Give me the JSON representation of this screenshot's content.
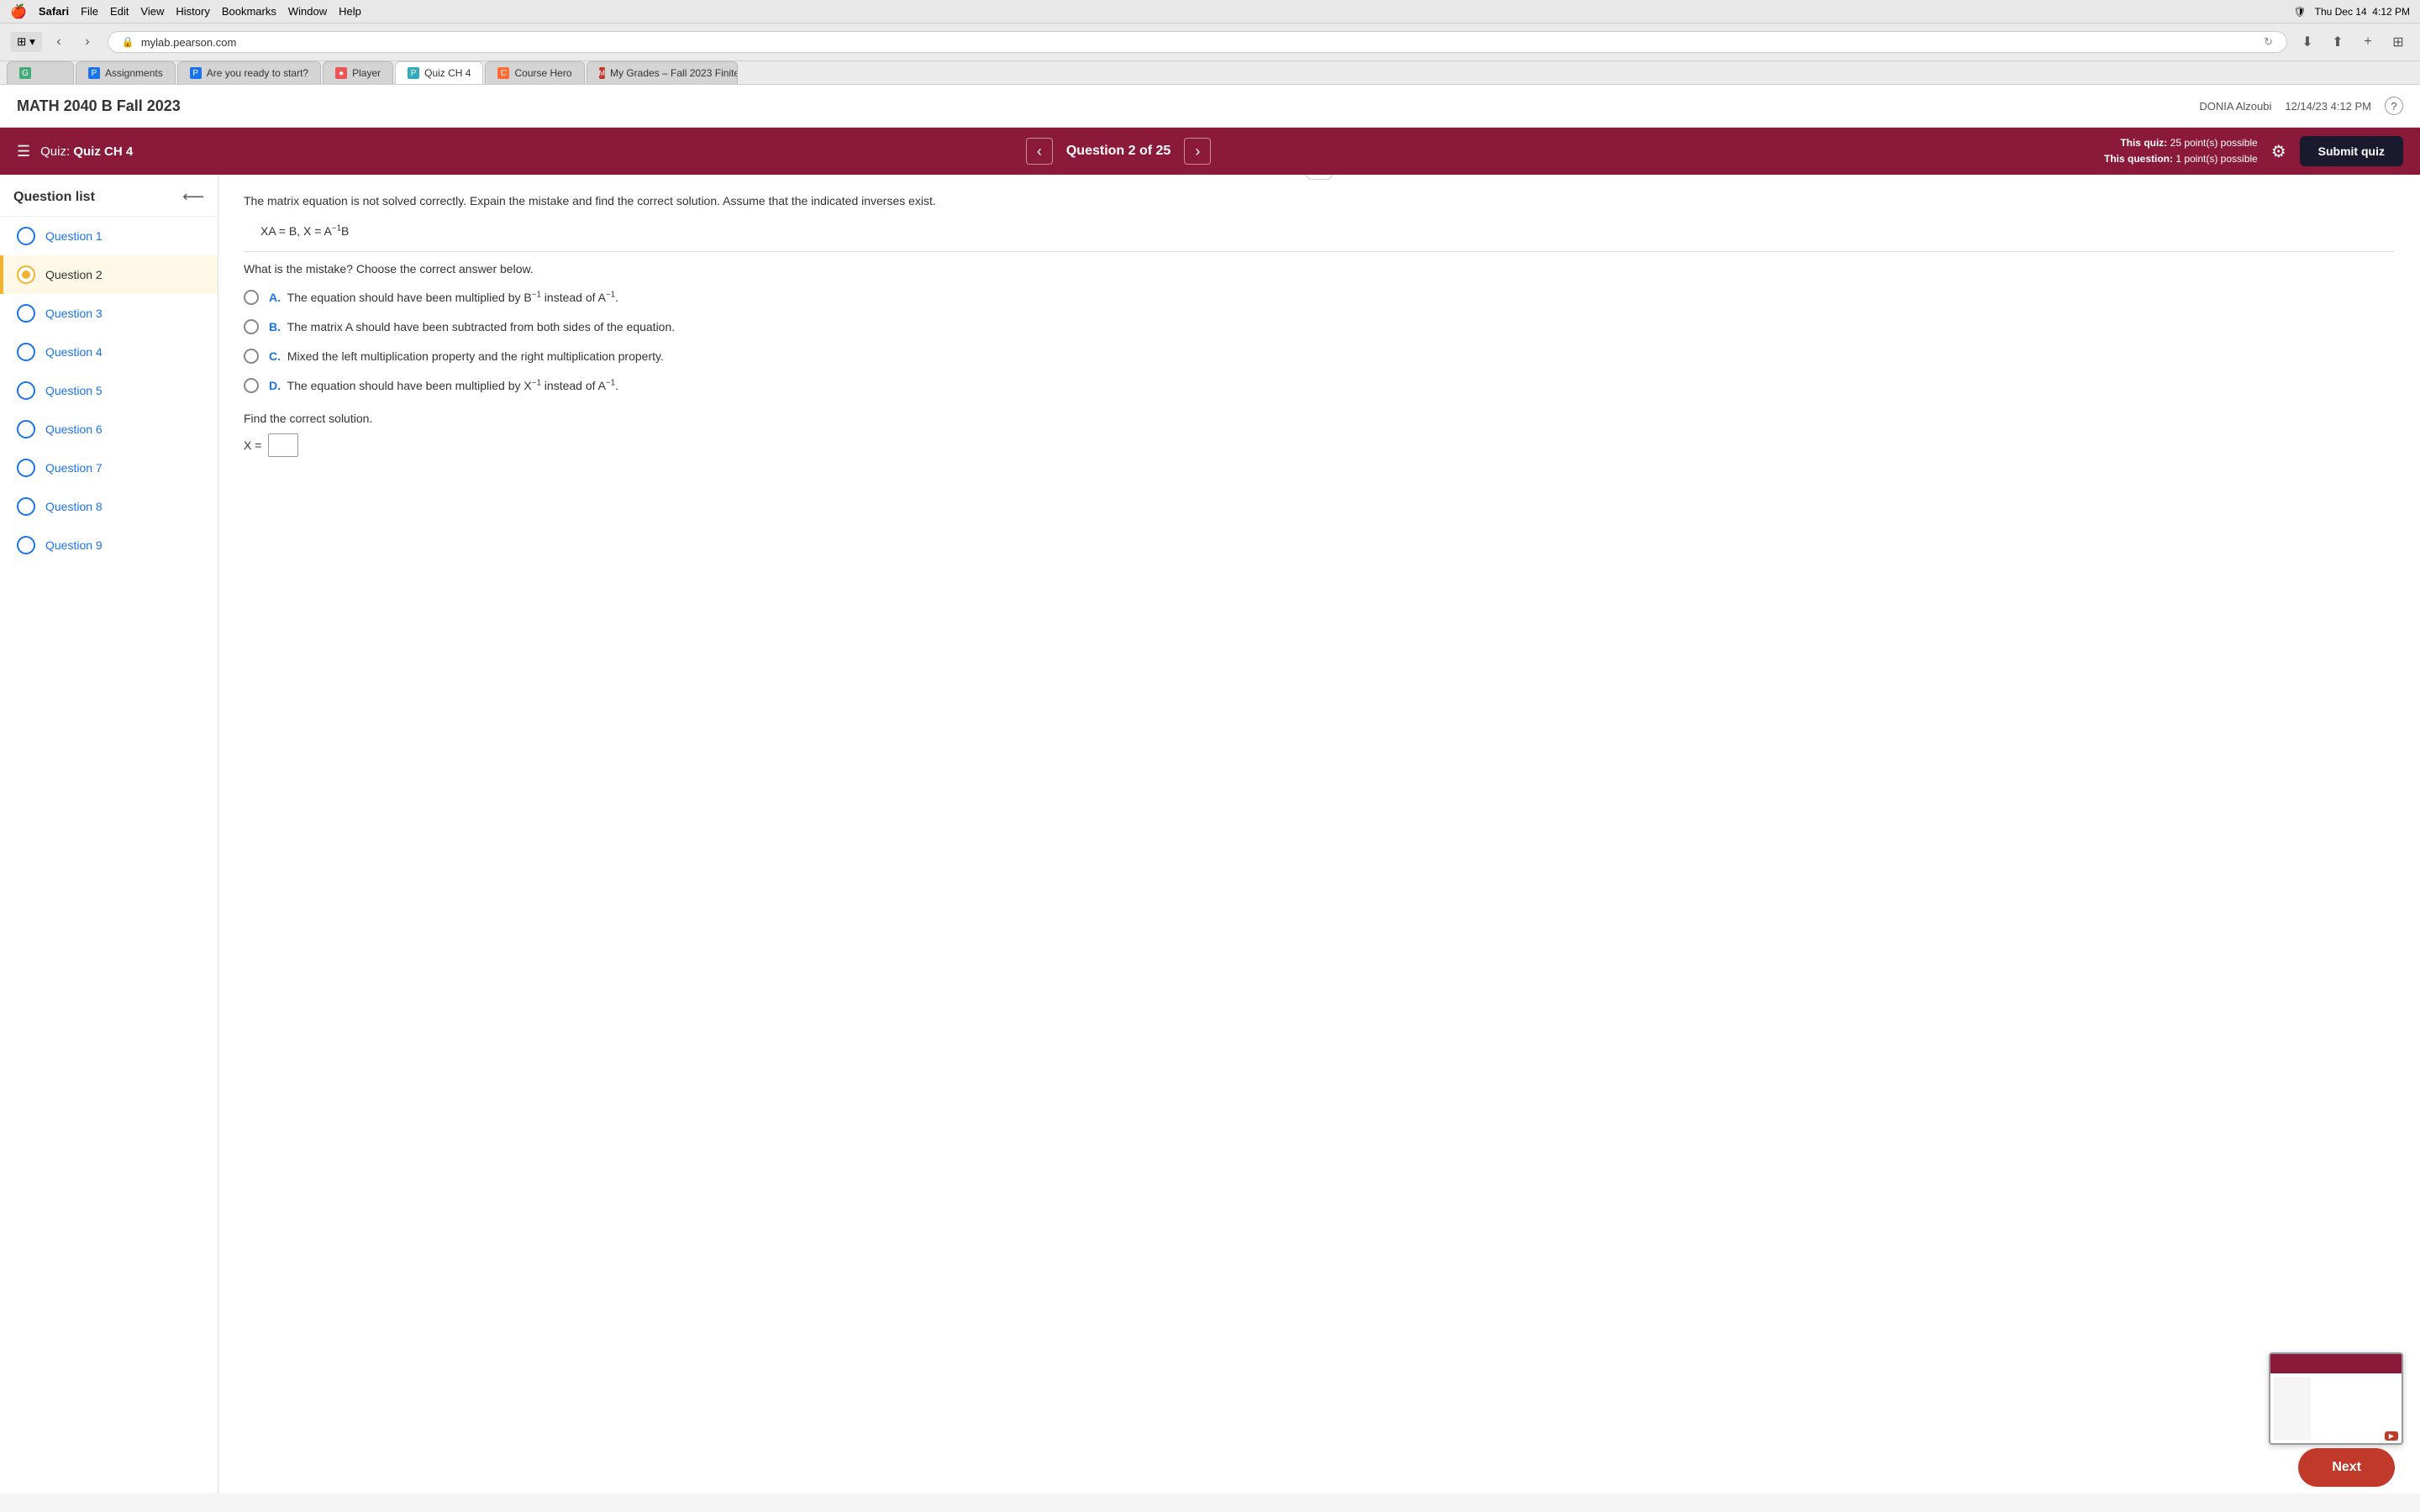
{
  "menubar": {
    "apple": "🍎",
    "items": [
      "Safari",
      "File",
      "Edit",
      "View",
      "History",
      "Bookmarks",
      "Window",
      "Help"
    ],
    "right_items": [
      "🛡",
      "Thu Dec 14",
      "4:12 PM"
    ]
  },
  "browser": {
    "address": "mylab.pearson.com",
    "lock_icon": "🔒"
  },
  "tabs": [
    {
      "id": "g-tab",
      "favicon_type": "green",
      "favicon_text": "G",
      "label": "",
      "active": false
    },
    {
      "id": "assignments-tab",
      "favicon_type": "blue",
      "favicon_text": "P",
      "label": "Assignments",
      "active": false
    },
    {
      "id": "start-tab",
      "favicon_type": "blue",
      "favicon_text": "P",
      "label": "Are you ready to start?",
      "active": false
    },
    {
      "id": "player-tab",
      "favicon_type": "red",
      "favicon_text": "●",
      "label": "Player",
      "active": false
    },
    {
      "id": "quiz-tab",
      "favicon_type": "lightblue",
      "favicon_text": "P",
      "label": "Quiz CH 4",
      "active": true
    },
    {
      "id": "coursehero-tab",
      "favicon_type": "coursehero",
      "favicon_text": "C",
      "label": "Course Hero",
      "active": false
    },
    {
      "id": "grades-tab",
      "favicon_type": "grades",
      "favicon_text": "M",
      "label": "My Grades – Fall 2023 Finite...",
      "active": false
    }
  ],
  "site_header": {
    "title": "MATH 2040 B Fall 2023",
    "user": "DONIA Alzoubi",
    "datetime": "12/14/23 4:12 PM",
    "help_icon": "?"
  },
  "quiz_header": {
    "menu_icon": "☰",
    "quiz_label": "Quiz:",
    "quiz_name": "Quiz CH 4",
    "prev_icon": "‹",
    "next_icon": "›",
    "question_indicator": "Question 2 of 25",
    "this_quiz_label": "This quiz:",
    "this_quiz_value": "25 point(s) possible",
    "this_question_label": "This question:",
    "this_question_value": "1 point(s) possible",
    "settings_icon": "⚙",
    "submit_btn": "Submit quiz"
  },
  "sidebar": {
    "title": "Question list",
    "collapse_icon": "⟵",
    "questions": [
      {
        "id": 1,
        "label": "Question 1",
        "active": false
      },
      {
        "id": 2,
        "label": "Question 2",
        "active": true
      },
      {
        "id": 3,
        "label": "Question 3",
        "active": false
      },
      {
        "id": 4,
        "label": "Question 4",
        "active": false
      },
      {
        "id": 5,
        "label": "Question 5",
        "active": false
      },
      {
        "id": 6,
        "label": "Question 6",
        "active": false
      },
      {
        "id": 7,
        "label": "Question 7",
        "active": false
      },
      {
        "id": 8,
        "label": "Question 8",
        "active": false
      },
      {
        "id": 9,
        "label": "Question 9",
        "active": false
      }
    ]
  },
  "question": {
    "prompt": "The matrix equation is not solved correctly. Expain the mistake and find the correct solution. Assume that the indicated inverses exist.",
    "equation": "XA = B, X = A⁻¹B",
    "sub_prompt": "What is the mistake? Choose the correct answer below.",
    "options": [
      {
        "id": "A",
        "letter": "A.",
        "text_before": "The equation should have been multiplied by B",
        "sup1": "−1",
        "text_middle": " instead of A",
        "sup2": "−1",
        "text_after": "."
      },
      {
        "id": "B",
        "letter": "B.",
        "text": "The matrix A should have been subtracted from both sides of the equation."
      },
      {
        "id": "C",
        "letter": "C.",
        "text": "Mixed the left multiplication property and the right multiplication property."
      },
      {
        "id": "D",
        "letter": "D.",
        "text_before": "The equation should have been multiplied by X",
        "sup1": "−1",
        "text_middle": " instead of A",
        "sup2": "−1",
        "text_after": "."
      }
    ],
    "correct_solution_label": "Find the correct solution.",
    "x_equals": "X =",
    "input_placeholder": ""
  },
  "next_button": {
    "label": "Next"
  }
}
